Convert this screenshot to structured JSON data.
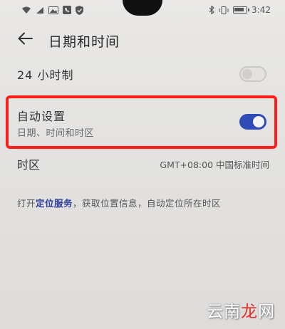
{
  "status_bar": {
    "left_icons": [
      "wifi-icon",
      "signal-icon",
      "image-icon",
      "phone-icon",
      "shield-icon"
    ],
    "right_icons": [
      "bluetooth-icon",
      "vibrate-icon",
      "battery-icon"
    ],
    "time": "3:42",
    "battery_level": 0.85
  },
  "header": {
    "title": "日期和时间",
    "back_icon": "arrow-left-icon"
  },
  "settings": {
    "hour24": {
      "label": "24 小时制",
      "enabled": false
    },
    "auto_set": {
      "label": "自动设置",
      "subtitle": "日期、时间和时区",
      "enabled": true
    },
    "timezone": {
      "label": "时区",
      "value": "GMT+08:00 中国标准时间"
    }
  },
  "location_note": {
    "prefix": "打开",
    "link": "定位服务",
    "suffix": "，获取位置信息，自动定位所在时区"
  },
  "watermark": {
    "part1": "云南",
    "part2": "龙",
    "part3": "网"
  },
  "colors": {
    "toggle_on": "#2e4bb6",
    "highlight": "#ff1f1a",
    "link": "#2d3f9a"
  }
}
